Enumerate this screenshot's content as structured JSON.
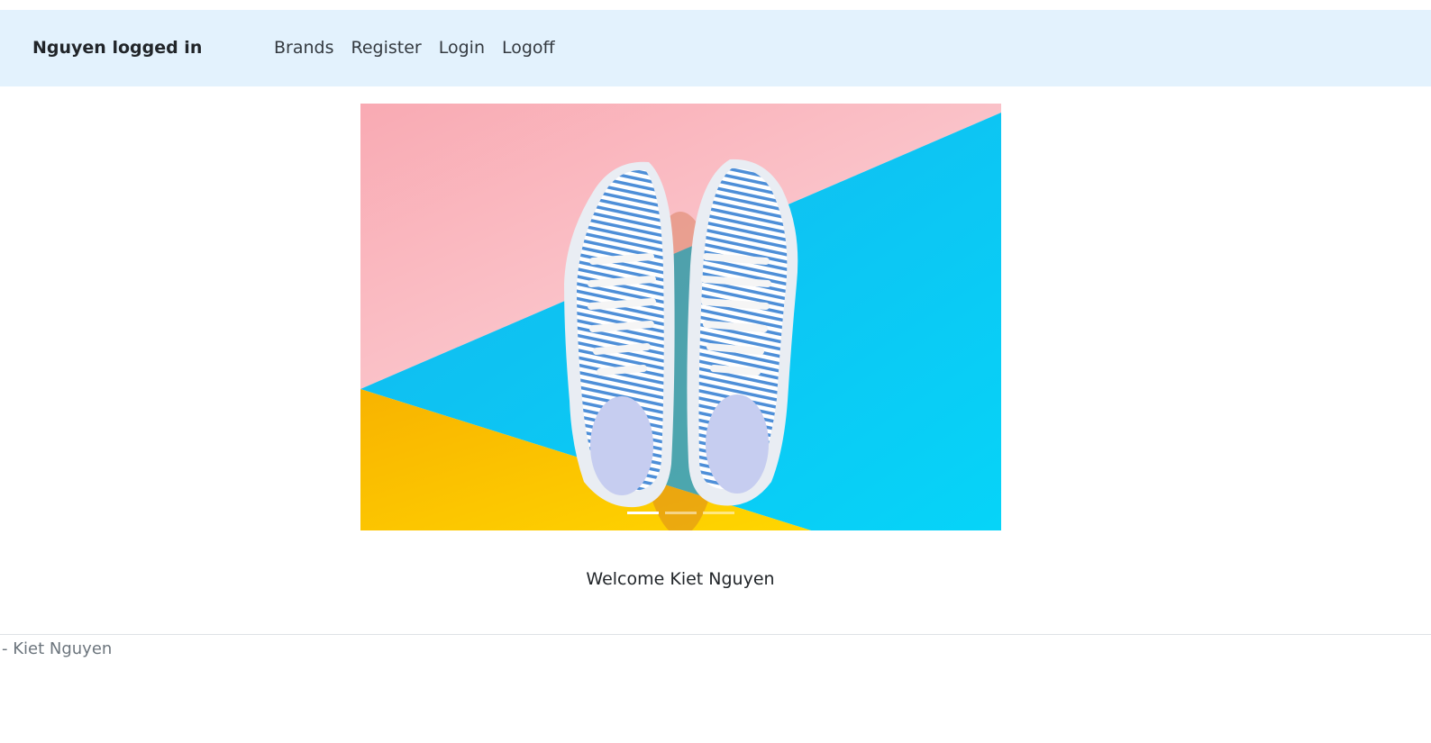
{
  "navbar": {
    "brand": "Nguyen logged in",
    "links": [
      "Brands",
      "Register",
      "Login",
      "Logoff"
    ],
    "background": "#e3f2fd"
  },
  "carousel": {
    "slide_count": 3,
    "active_index": 0,
    "image_subject": "blue striped sneakers on pink, blue and yellow background"
  },
  "main": {
    "welcome": "Welcome Kiet Nguyen"
  },
  "footer": {
    "text": "- Kiet Nguyen"
  }
}
